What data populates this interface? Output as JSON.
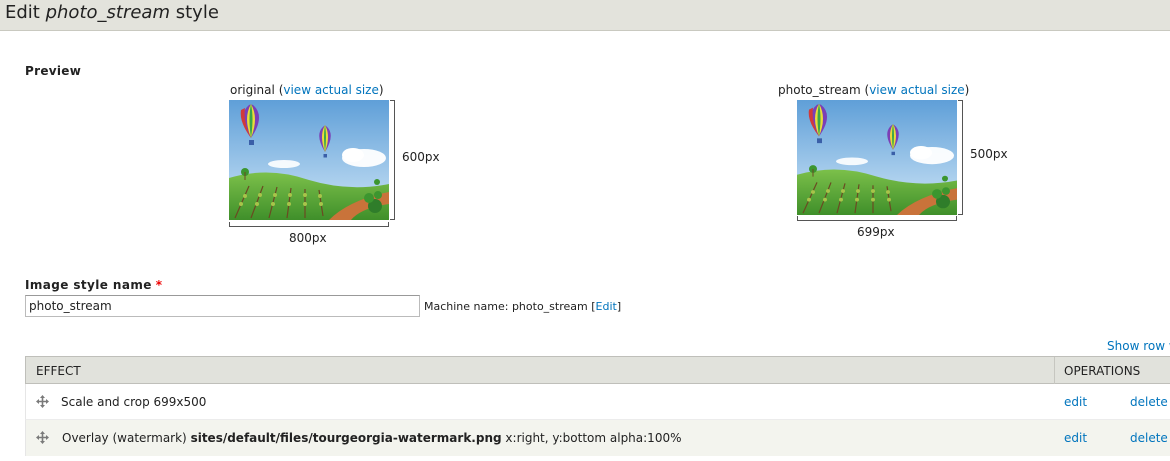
{
  "header": {
    "title_prefix": "Edit",
    "style_name": "photo_stream",
    "title_suffix": "style"
  },
  "preview": {
    "label": "Preview",
    "original": {
      "name": "original",
      "paren_open": "(",
      "link": "view actual size",
      "paren_close": ")",
      "width_label": "800px",
      "height_label": "600px"
    },
    "derivative": {
      "name": "photo_stream",
      "paren_open": "(",
      "link": "view actual size",
      "paren_close": ")",
      "width_label": "699px",
      "height_label": "500px"
    }
  },
  "form": {
    "label": "Image style name",
    "required_marker": "*",
    "value": "photo_stream",
    "machine_prefix": "Machine name: photo_stream",
    "machine_edit_open": "[",
    "machine_edit": "Edit",
    "machine_edit_close": "]"
  },
  "table": {
    "show_row_weights": "Show row weights",
    "header_effect": "EFFECT",
    "header_operations": "OPERATIONS",
    "rows": [
      {
        "effect": "Scale and crop 699x500",
        "edit": "edit",
        "delete": "delete"
      },
      {
        "effect_prefix": "Overlay (watermark)",
        "effect_path": "sites/default/files/tourgeorgia-watermark.png",
        "effect_suffix": "x:right, y:bottom alpha:100%",
        "edit": "edit",
        "delete": "delete"
      }
    ]
  },
  "colors": {
    "link": "#0074bd",
    "header_bg": "#e3e3dc",
    "required": "#ee0000"
  },
  "icons": [
    "drag-handle-icon",
    "balloon-image"
  ]
}
